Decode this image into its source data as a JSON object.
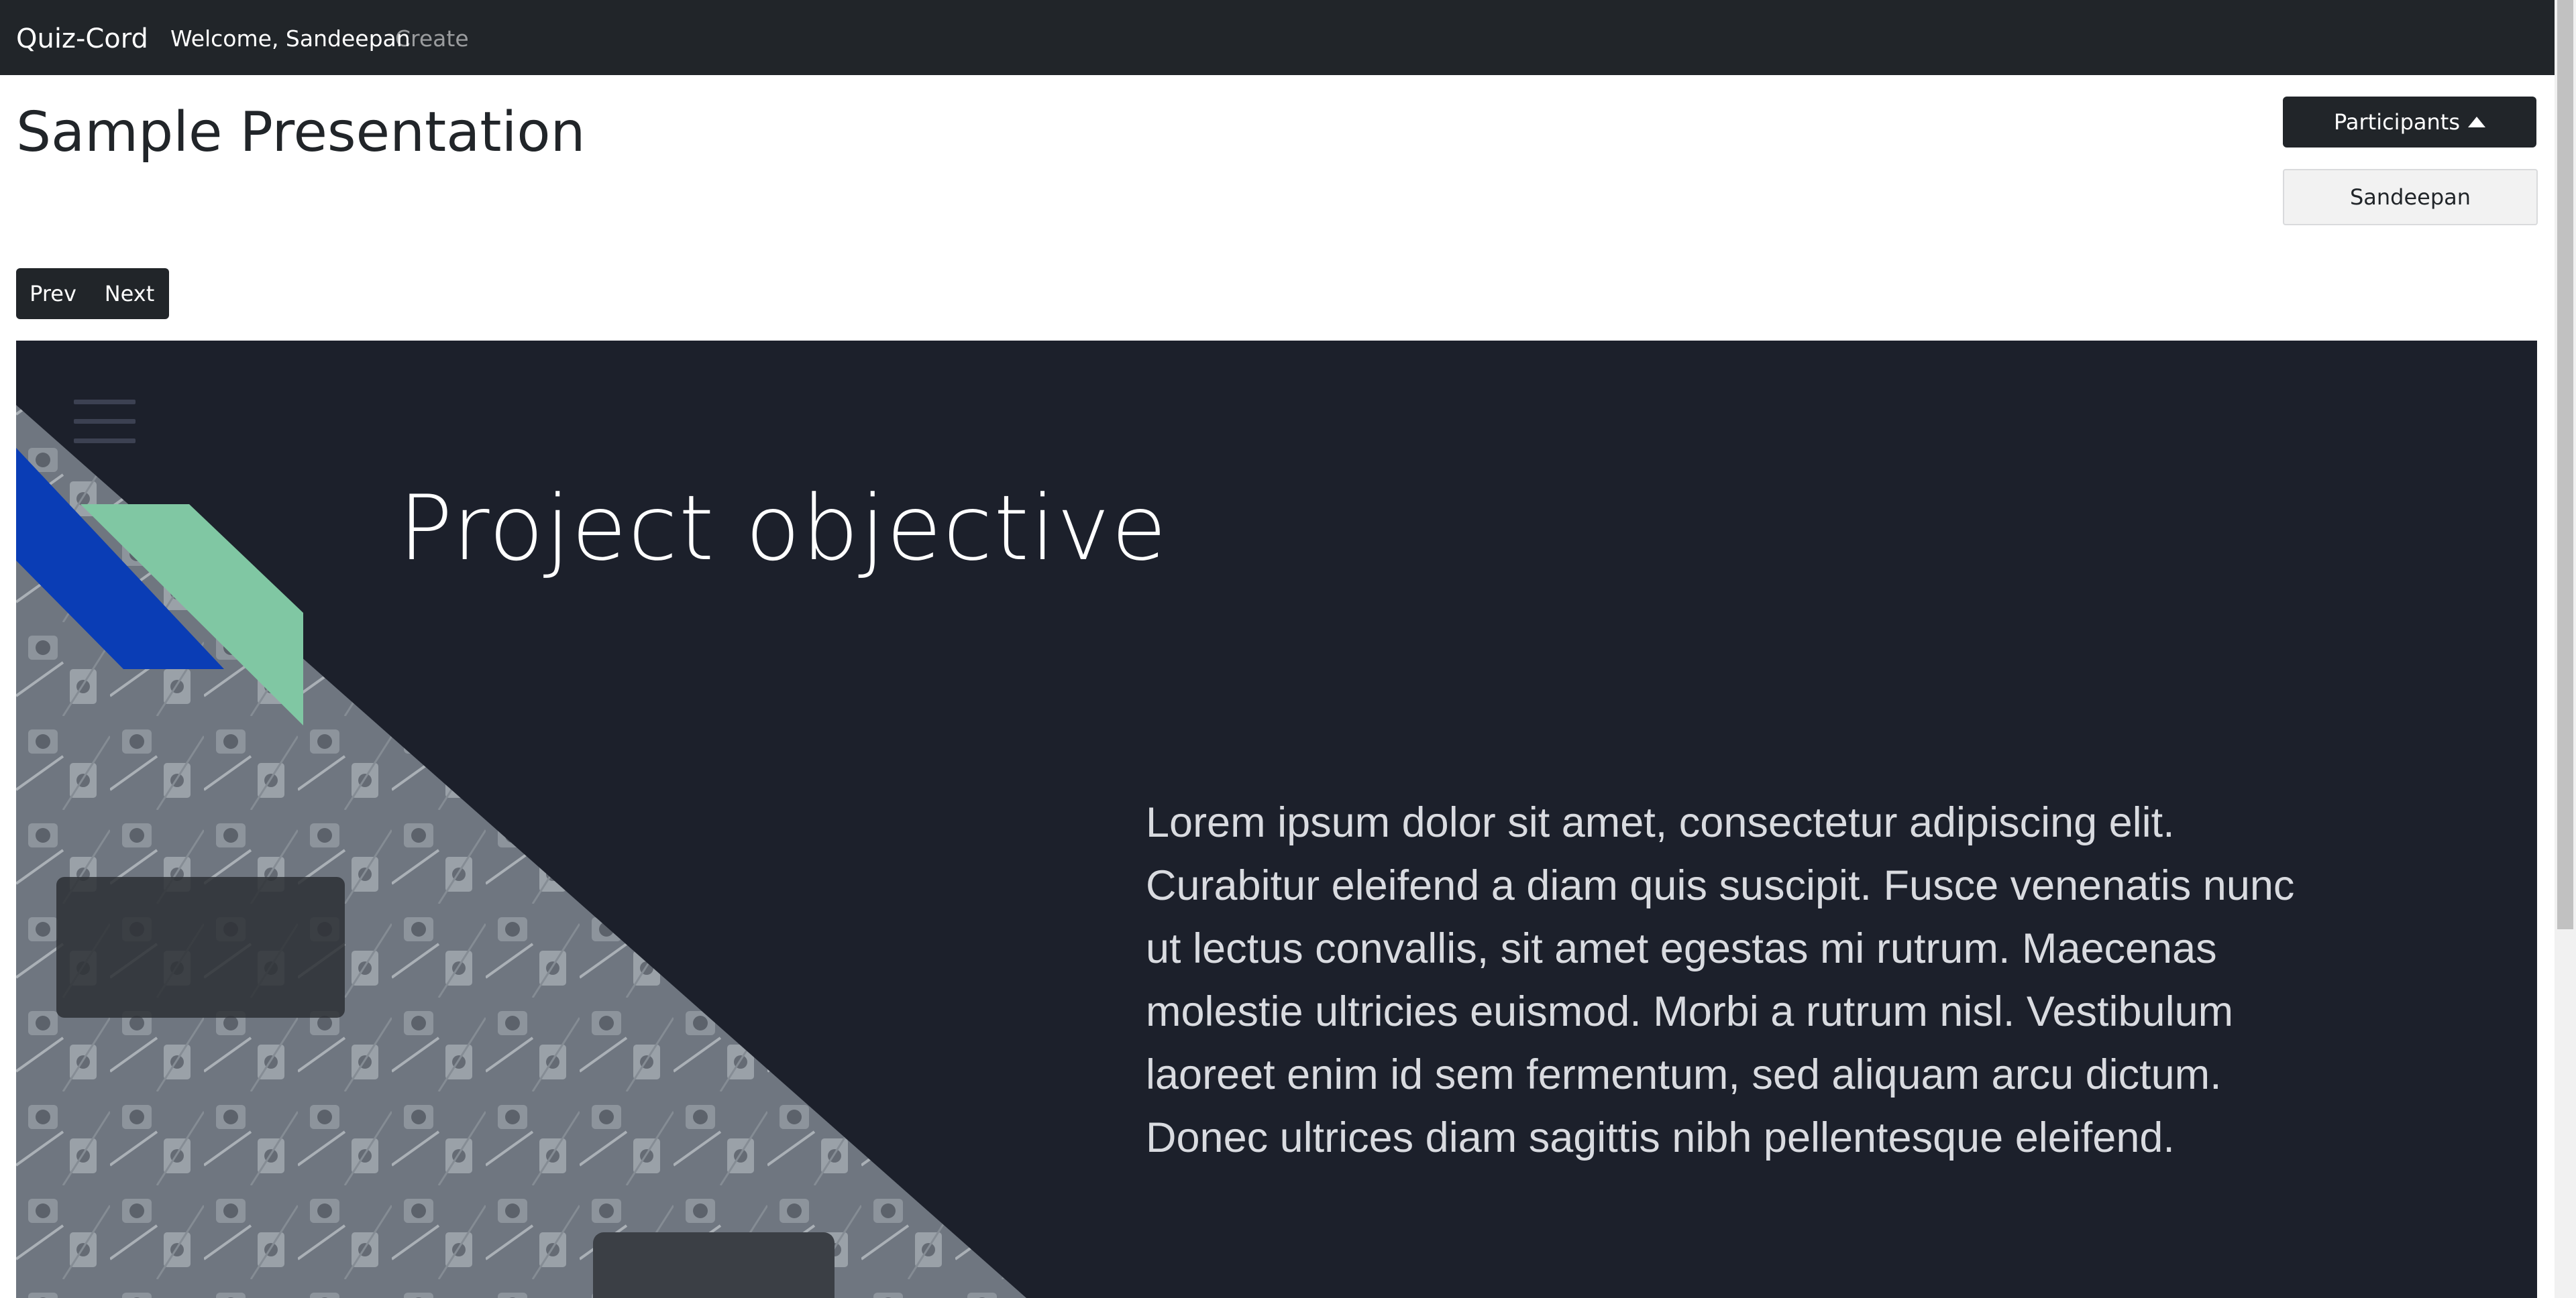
{
  "navbar": {
    "brand": "Quiz-Cord",
    "welcome": "Welcome, Sandeepan",
    "create": "Create"
  },
  "page": {
    "title": "Sample Presentation"
  },
  "participants": {
    "button_label": "Participants",
    "icon": "caret-up-icon",
    "list": [
      "Sandeepan"
    ]
  },
  "controls": {
    "prev_label": "Prev",
    "next_label": "Next"
  },
  "slide": {
    "title": "Project objective",
    "body": "Lorem ipsum dolor sit amet, consectetur adipiscing elit. Curabitur eleifend a diam quis suscipit. Fusce venenatis nunc ut lectus convallis, sit amet egestas mi rutrum. Maecenas molestie ultricies euismod. Morbi a rutrum nisl. Vestibulum laoreet enim id sem fermentum, sed aliquam arcu dictum. Donec ultrices diam sagittis nibh pellentesque eleifend.",
    "menu_icon": "hamburger-menu-icon",
    "colors": {
      "background": "#1c202b",
      "accent_blue": "#0a3db5",
      "accent_green": "#80c7a3"
    }
  }
}
